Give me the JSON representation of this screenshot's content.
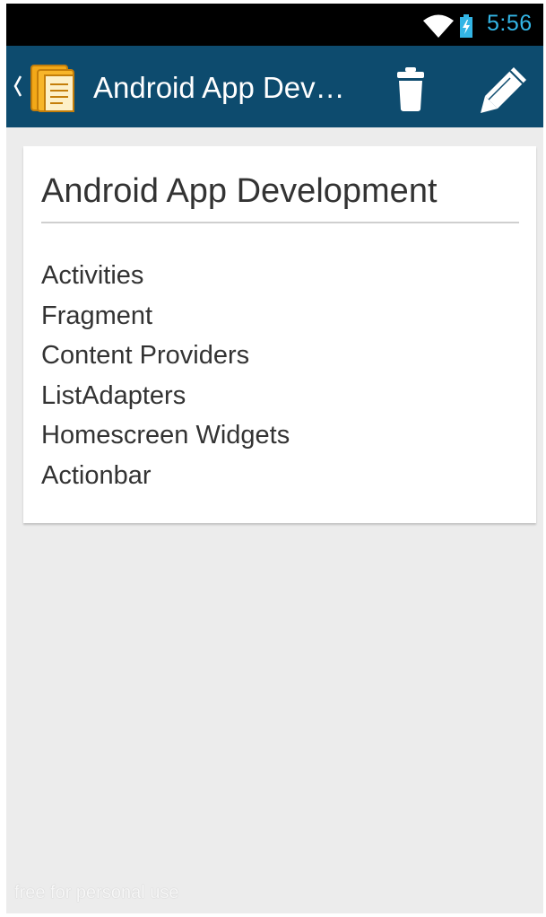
{
  "status_bar": {
    "time": "5:56",
    "icons": [
      "wifi-icon",
      "battery-charging-icon"
    ],
    "clock_color": "#33b5e5"
  },
  "action_bar": {
    "title": "Android App Dev…",
    "background_color": "#0d4b6e",
    "icons": [
      "up-caret-icon",
      "notes-app-icon",
      "trash-icon",
      "pencil-icon"
    ]
  },
  "note": {
    "title": "Android App Development",
    "items": [
      "Activities",
      "Fragment",
      "Content Providers",
      "ListAdapters",
      "Homescreen Widgets",
      "Actionbar"
    ]
  },
  "watermark": "free for personal use"
}
